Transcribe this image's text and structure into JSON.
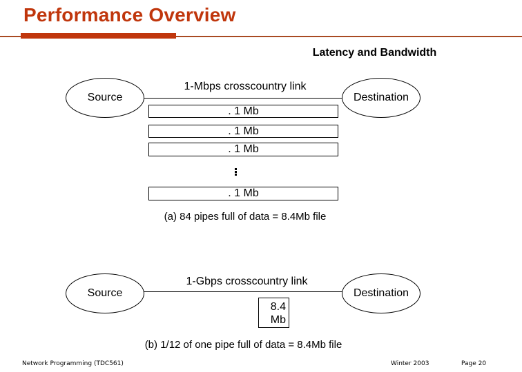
{
  "slide": {
    "title": "Performance Overview",
    "subtitle": "Latency and Bandwidth",
    "accent_color": "#c0360c"
  },
  "diagram_a": {
    "source_label": "Source",
    "destination_label": "Destination",
    "link_label": "1-Mbps crosscountry link",
    "pipes": [
      {
        "label": ". 1 Mb"
      },
      {
        "label": ". 1 Mb"
      },
      {
        "label": ". 1 Mb"
      },
      {
        "label": ". 1 Mb"
      }
    ],
    "ellipsis_icon": "vertical-ellipsis",
    "caption": "(a) 84 pipes full of data =  8.4Mb file"
  },
  "diagram_b": {
    "source_label": "Source",
    "destination_label": "Destination",
    "link_label": "1-Gbps crosscountry link",
    "data_box_line1": "8.4",
    "data_box_line2": "Mb",
    "caption": "(b) 1/12 of one pipe full of data = 8.4Mb file"
  },
  "footer": {
    "course": "Network Programming (TDC561)",
    "term": "Winter  2003",
    "page": "Page 20"
  }
}
